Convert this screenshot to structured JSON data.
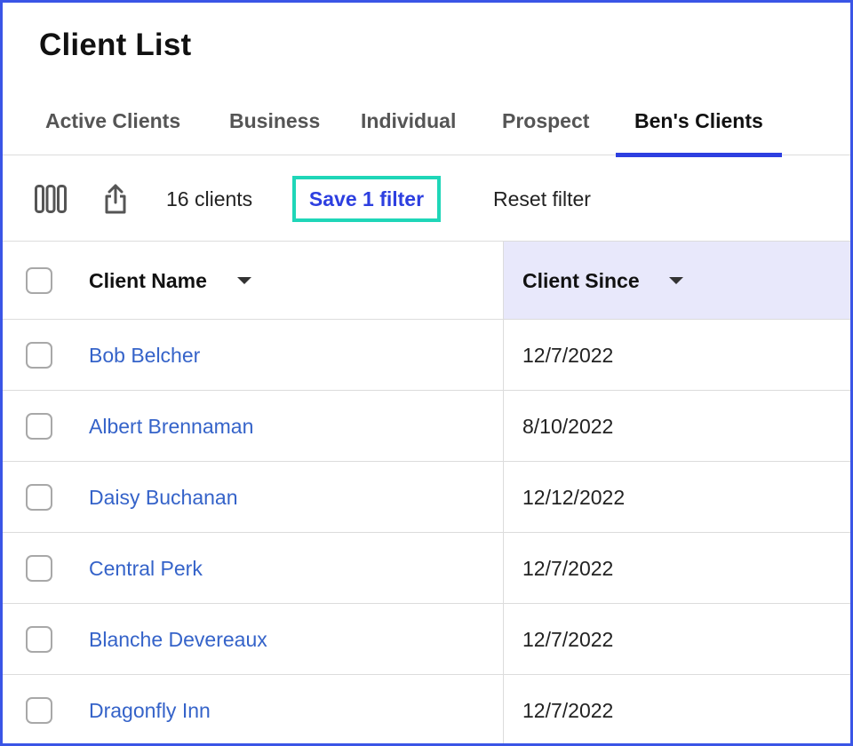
{
  "page": {
    "title": "Client List"
  },
  "tabs": [
    {
      "label": "Active Clients",
      "active": false
    },
    {
      "label": "Business",
      "active": false
    },
    {
      "label": "Individual",
      "active": false
    },
    {
      "label": "Prospect",
      "active": false
    },
    {
      "label": "Ben's Clients",
      "active": true
    }
  ],
  "toolbar": {
    "columns_icon": "columns-icon",
    "share_icon": "share-icon",
    "count_label": "16 clients",
    "save_filter_label": "Save 1 filter",
    "reset_filter_label": "Reset filter"
  },
  "table": {
    "columns": [
      {
        "label": "Client Name",
        "sort_icon": "caret-down-icon"
      },
      {
        "label": "Client Since",
        "sort_icon": "caret-down-icon",
        "highlighted": true
      }
    ],
    "rows": [
      {
        "name": "Bob Belcher",
        "since": "12/7/2022"
      },
      {
        "name": "Albert Brennaman",
        "since": "8/10/2022"
      },
      {
        "name": "Daisy Buchanan",
        "since": "12/12/2022"
      },
      {
        "name": "Central Perk",
        "since": "12/7/2022"
      },
      {
        "name": "Blanche Devereaux",
        "since": "12/7/2022"
      },
      {
        "name": "Dragonfly Inn",
        "since": "12/7/2022"
      }
    ]
  },
  "colors": {
    "accent": "#2d3fe0",
    "highlight_border": "#1fd6b8",
    "link": "#3563c9",
    "frame_border": "#3a55e6",
    "header_highlight": "#e8e8fb"
  }
}
